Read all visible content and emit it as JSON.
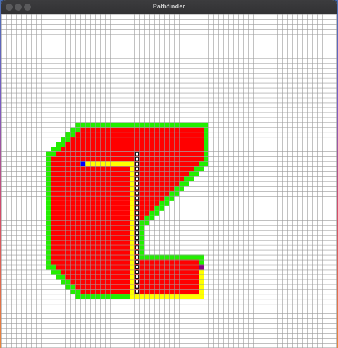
{
  "window": {
    "title": "Pathfinder"
  },
  "grid": {
    "cols": 68,
    "rows": 68,
    "colors": {
      "background": "#ffffff",
      "gridline": "#9a9a9a",
      "obstacle": "#ff0000",
      "boundary": "#22ee00",
      "path": "#ffff00",
      "frontier": "#111111",
      "start": "#0000ff",
      "end": "#880088"
    },
    "obstacle_rows": [
      {
        "row": 23,
        "from": 16,
        "to": 40
      },
      {
        "row": 24,
        "from": 15,
        "to": 40
      },
      {
        "row": 25,
        "from": 14,
        "to": 40
      },
      {
        "row": 26,
        "from": 13,
        "to": 40
      },
      {
        "row": 27,
        "from": 12,
        "to": 40
      },
      {
        "row": 28,
        "from": 11,
        "to": 40
      },
      {
        "row": 29,
        "from": 10,
        "to": 40
      },
      {
        "row": 30,
        "from": 10,
        "to": 39
      },
      {
        "row": 31,
        "from": 10,
        "to": 38
      },
      {
        "row": 32,
        "from": 10,
        "to": 37
      },
      {
        "row": 33,
        "from": 10,
        "to": 36
      },
      {
        "row": 34,
        "from": 10,
        "to": 35
      },
      {
        "row": 35,
        "from": 10,
        "to": 34
      },
      {
        "row": 36,
        "from": 10,
        "to": 33
      },
      {
        "row": 37,
        "from": 10,
        "to": 32
      },
      {
        "row": 38,
        "from": 10,
        "to": 31
      },
      {
        "row": 39,
        "from": 10,
        "to": 30
      },
      {
        "row": 40,
        "from": 10,
        "to": 29
      },
      {
        "row": 41,
        "from": 10,
        "to": 28
      },
      {
        "row": 42,
        "from": 10,
        "to": 27
      },
      {
        "row": 43,
        "from": 10,
        "to": 27
      },
      {
        "row": 44,
        "from": 10,
        "to": 27
      },
      {
        "row": 45,
        "from": 10,
        "to": 27
      },
      {
        "row": 46,
        "from": 10,
        "to": 27
      },
      {
        "row": 47,
        "from": 10,
        "to": 27
      },
      {
        "row": 48,
        "from": 10,
        "to": 27
      },
      {
        "row": 49,
        "from": 10,
        "to": 27
      },
      {
        "row": 50,
        "from": 10,
        "to": 39
      },
      {
        "row": 51,
        "from": 11,
        "to": 39
      },
      {
        "row": 52,
        "from": 12,
        "to": 39
      },
      {
        "row": 53,
        "from": 13,
        "to": 39
      },
      {
        "row": 54,
        "from": 14,
        "to": 39
      },
      {
        "row": 55,
        "from": 15,
        "to": 39
      },
      {
        "row": 56,
        "from": 16,
        "to": 39
      }
    ],
    "path_cells": [
      [
        16,
        30
      ],
      [
        17,
        30
      ],
      [
        18,
        30
      ],
      [
        19,
        30
      ],
      [
        20,
        30
      ],
      [
        21,
        30
      ],
      [
        22,
        30
      ],
      [
        23,
        30
      ],
      [
        24,
        30
      ],
      [
        25,
        30
      ],
      [
        26,
        30
      ],
      [
        26,
        31
      ],
      [
        26,
        32
      ],
      [
        26,
        33
      ],
      [
        26,
        34
      ],
      [
        26,
        35
      ],
      [
        26,
        36
      ],
      [
        26,
        37
      ],
      [
        26,
        38
      ],
      [
        26,
        39
      ],
      [
        26,
        40
      ],
      [
        26,
        41
      ],
      [
        26,
        42
      ],
      [
        26,
        43
      ],
      [
        26,
        44
      ],
      [
        26,
        45
      ],
      [
        26,
        46
      ],
      [
        26,
        47
      ],
      [
        26,
        48
      ],
      [
        26,
        49
      ],
      [
        26,
        50
      ],
      [
        26,
        51
      ],
      [
        26,
        52
      ],
      [
        26,
        53
      ],
      [
        26,
        54
      ],
      [
        26,
        55
      ],
      [
        26,
        56
      ],
      [
        26,
        57
      ],
      [
        27,
        57
      ],
      [
        28,
        57
      ],
      [
        29,
        57
      ],
      [
        30,
        57
      ],
      [
        31,
        57
      ],
      [
        32,
        57
      ],
      [
        33,
        57
      ],
      [
        34,
        57
      ],
      [
        35,
        57
      ],
      [
        36,
        57
      ],
      [
        37,
        57
      ],
      [
        38,
        57
      ],
      [
        39,
        57
      ],
      [
        40,
        57
      ],
      [
        40,
        56
      ],
      [
        40,
        55
      ],
      [
        40,
        54
      ],
      [
        40,
        53
      ],
      [
        40,
        52
      ]
    ],
    "frontier_cells": [
      [
        27,
        28
      ],
      [
        27,
        29
      ],
      [
        27,
        30
      ],
      [
        27,
        31
      ],
      [
        27,
        32
      ],
      [
        27,
        33
      ],
      [
        27,
        34
      ],
      [
        27,
        35
      ],
      [
        27,
        36
      ],
      [
        27,
        37
      ],
      [
        27,
        38
      ],
      [
        27,
        39
      ],
      [
        27,
        40
      ],
      [
        27,
        41
      ],
      [
        27,
        42
      ],
      [
        27,
        43
      ],
      [
        27,
        44
      ],
      [
        27,
        45
      ],
      [
        27,
        46
      ],
      [
        27,
        47
      ],
      [
        27,
        48
      ],
      [
        27,
        49
      ],
      [
        27,
        50
      ],
      [
        27,
        51
      ],
      [
        27,
        52
      ],
      [
        27,
        53
      ],
      [
        27,
        54
      ],
      [
        27,
        55
      ],
      [
        27,
        56
      ]
    ],
    "start_cell": [
      16,
      30
    ],
    "end_cell": [
      40,
      51
    ]
  }
}
